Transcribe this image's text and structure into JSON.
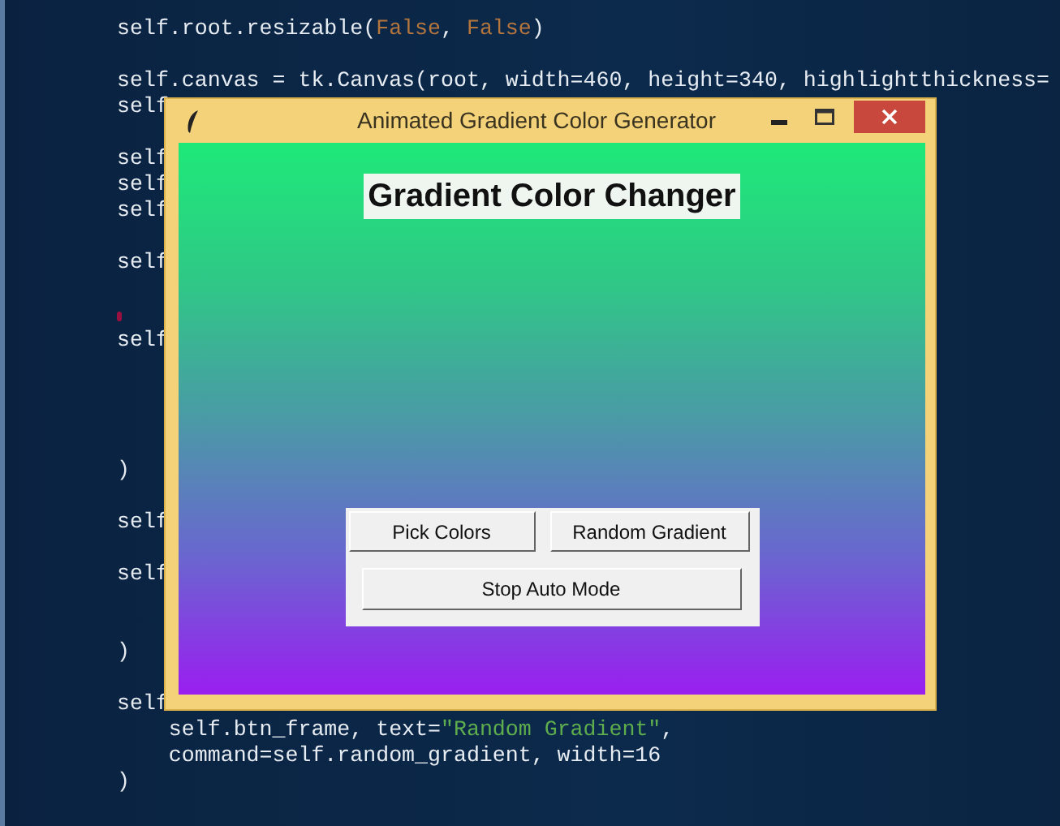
{
  "editor": {
    "lines": [
      {
        "kind": "code",
        "segments": [
          {
            "kind": "plain",
            "text": "self.root.resizable("
          },
          {
            "kind": "keyword",
            "text": "False"
          },
          {
            "kind": "plain",
            "text": ", "
          },
          {
            "kind": "keyword",
            "text": "False"
          },
          {
            "kind": "plain",
            "text": ")"
          }
        ]
      },
      {
        "kind": "blank"
      },
      {
        "kind": "code",
        "segments": [
          {
            "kind": "plain",
            "text": "self.canvas = tk.Canvas(root, width=460, height=340, highlightthickness="
          }
        ]
      },
      {
        "kind": "code",
        "segments": [
          {
            "kind": "plain",
            "text": "self"
          }
        ]
      },
      {
        "kind": "blank"
      },
      {
        "kind": "code",
        "segments": [
          {
            "kind": "plain",
            "text": "self"
          }
        ]
      },
      {
        "kind": "code",
        "segments": [
          {
            "kind": "plain",
            "text": "self"
          }
        ]
      },
      {
        "kind": "code",
        "segments": [
          {
            "kind": "plain",
            "text": "self"
          }
        ]
      },
      {
        "kind": "blank"
      },
      {
        "kind": "code",
        "segments": [
          {
            "kind": "plain",
            "text": "self"
          }
        ]
      },
      {
        "kind": "blank"
      },
      {
        "kind": "marker"
      },
      {
        "kind": "code",
        "segments": [
          {
            "kind": "plain",
            "text": "self"
          }
        ]
      },
      {
        "kind": "blank"
      },
      {
        "kind": "blank"
      },
      {
        "kind": "blank"
      },
      {
        "kind": "blank"
      },
      {
        "kind": "code",
        "segments": [
          {
            "kind": "plain",
            "text": ")"
          }
        ]
      },
      {
        "kind": "blank"
      },
      {
        "kind": "code",
        "segments": [
          {
            "kind": "plain",
            "text": "self"
          }
        ]
      },
      {
        "kind": "blank"
      },
      {
        "kind": "code",
        "segments": [
          {
            "kind": "plain",
            "text": "self"
          }
        ]
      },
      {
        "kind": "blank"
      },
      {
        "kind": "blank"
      },
      {
        "kind": "code",
        "segments": [
          {
            "kind": "plain",
            "text": ")"
          }
        ]
      },
      {
        "kind": "blank"
      },
      {
        "kind": "code",
        "segments": [
          {
            "kind": "plain",
            "text": "self"
          }
        ]
      },
      {
        "kind": "code",
        "segments": [
          {
            "kind": "plain",
            "text": "    self.btn_frame, text="
          },
          {
            "kind": "string",
            "text": "\"Random Gradient\""
          },
          {
            "kind": "plain",
            "text": ","
          }
        ]
      },
      {
        "kind": "code",
        "segments": [
          {
            "kind": "plain",
            "text": "    command=self.random_gradient, width=16"
          }
        ]
      },
      {
        "kind": "code",
        "segments": [
          {
            "kind": "plain",
            "text": ")"
          }
        ]
      }
    ]
  },
  "window": {
    "title": "Animated Gradient Color Generator",
    "heading": "Gradient Color Changer",
    "buttons": [
      {
        "label": "Pick Colors",
        "kind": "half"
      },
      {
        "label": "Random Gradient",
        "kind": "half"
      },
      {
        "label": "Stop Auto Mode",
        "kind": "full"
      }
    ]
  }
}
